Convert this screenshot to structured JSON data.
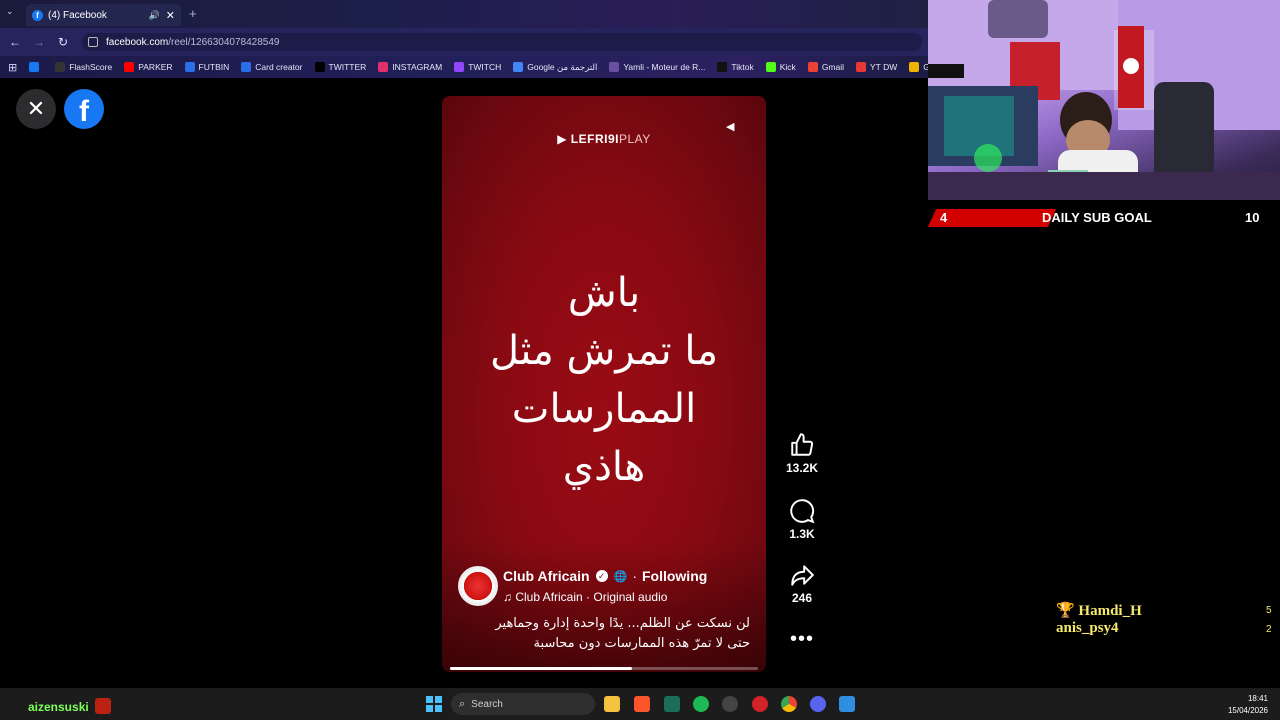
{
  "browser": {
    "tab_title": "(4) Facebook",
    "tab_favicon": "f",
    "url_host": "facebook.com",
    "url_path": "/reel/1266304078428549",
    "bookmarks": [
      {
        "label": "",
        "icon": "facebook-icon",
        "color": "#1877f2"
      },
      {
        "label": "FlashScore",
        "icon": "flashscore-icon",
        "color": "#333333"
      },
      {
        "label": "PARKER",
        "icon": "youtube-icon",
        "color": "#ff0000"
      },
      {
        "label": "FUTBIN",
        "icon": "futbin-icon",
        "color": "#2a6ee8"
      },
      {
        "label": "Card creator",
        "icon": "card-creator-icon",
        "color": "#2a6ee8"
      },
      {
        "label": "TWITTER",
        "icon": "x-icon",
        "color": "#000000"
      },
      {
        "label": "INSTAGRAM",
        "icon": "instagram-icon",
        "color": "#e1306c"
      },
      {
        "label": "TWITCH",
        "icon": "twitch-icon",
        "color": "#9146ff"
      },
      {
        "label": "Google الترجمة من",
        "icon": "google-translate-icon",
        "color": "#4285f4"
      },
      {
        "label": "Yamli - Moteur de R...",
        "icon": "yamli-icon",
        "color": "#6b4fa0"
      },
      {
        "label": "Tiktok",
        "icon": "tiktok-icon",
        "color": "#111111"
      },
      {
        "label": "Kick",
        "icon": "kick-icon",
        "color": "#53fc18"
      },
      {
        "label": "Gmail",
        "icon": "gmail-icon",
        "color": "#ea4335"
      },
      {
        "label": "YT DW",
        "icon": "download-icon",
        "color": "#e53935"
      },
      {
        "label": "GettyImages - H",
        "icon": "folder-icon",
        "color": "#f0b400"
      }
    ]
  },
  "reel": {
    "brand": "LEFRI9I",
    "brand_suffix": "PLAY",
    "overlay_lines": [
      "باش",
      "ما تمرش مثل",
      "الممارسات",
      "هاذي"
    ],
    "account_name": "Club Africain",
    "follow_state": "Following",
    "audio": "♫ Club Africain · Original audio",
    "caption_lines": [
      "لن نسكت عن الظلم... يدًا واحدة إدارة وجماهير",
      "حتى لا تمرّ هذه الممارسات دون محاسبة"
    ],
    "progress": 0.59
  },
  "actions": {
    "likes": "13.2K",
    "comments": "1.3K",
    "shares": "246"
  },
  "overlay": {
    "sub_goal_label": "DAILY SUB GOAL",
    "sub_goal_current": "4",
    "sub_goal_target": "10",
    "chat": [
      {
        "name": "🏆 Hamdi_H",
        "value": "5"
      },
      {
        "name": "anis_psy4",
        "value": "2"
      }
    ],
    "colors": {
      "goal_red": "#d30000",
      "chat_yellow": "#f5e96a"
    }
  },
  "taskbar": {
    "username": "aizensuski",
    "search_placeholder": "Search",
    "time": "18:41",
    "date": "15/04/2026"
  }
}
